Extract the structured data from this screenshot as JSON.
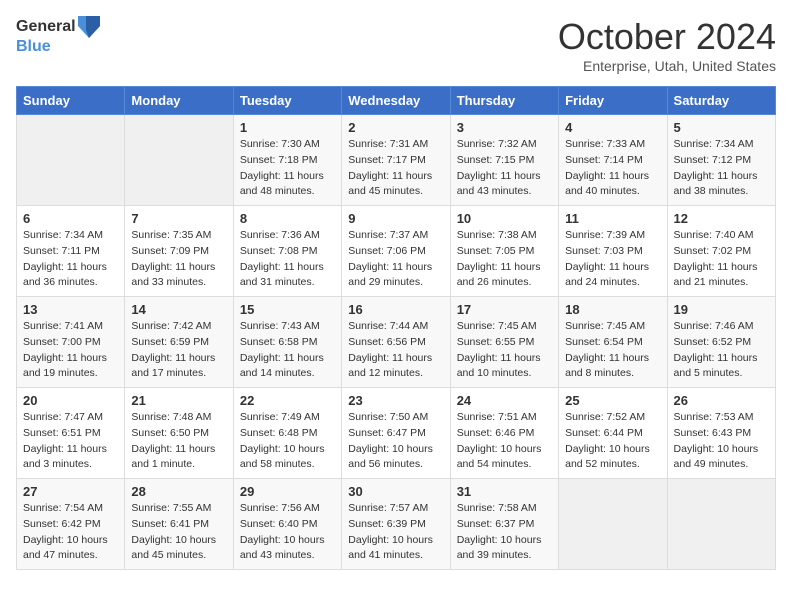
{
  "header": {
    "logo_general": "General",
    "logo_blue": "Blue",
    "month_title": "October 2024",
    "subtitle": "Enterprise, Utah, United States"
  },
  "weekdays": [
    "Sunday",
    "Monday",
    "Tuesday",
    "Wednesday",
    "Thursday",
    "Friday",
    "Saturday"
  ],
  "weeks": [
    [
      {
        "day": "",
        "sunrise": "",
        "sunset": "",
        "daylight": ""
      },
      {
        "day": "",
        "sunrise": "",
        "sunset": "",
        "daylight": ""
      },
      {
        "day": "1",
        "sunrise": "Sunrise: 7:30 AM",
        "sunset": "Sunset: 7:18 PM",
        "daylight": "Daylight: 11 hours and 48 minutes."
      },
      {
        "day": "2",
        "sunrise": "Sunrise: 7:31 AM",
        "sunset": "Sunset: 7:17 PM",
        "daylight": "Daylight: 11 hours and 45 minutes."
      },
      {
        "day": "3",
        "sunrise": "Sunrise: 7:32 AM",
        "sunset": "Sunset: 7:15 PM",
        "daylight": "Daylight: 11 hours and 43 minutes."
      },
      {
        "day": "4",
        "sunrise": "Sunrise: 7:33 AM",
        "sunset": "Sunset: 7:14 PM",
        "daylight": "Daylight: 11 hours and 40 minutes."
      },
      {
        "day": "5",
        "sunrise": "Sunrise: 7:34 AM",
        "sunset": "Sunset: 7:12 PM",
        "daylight": "Daylight: 11 hours and 38 minutes."
      }
    ],
    [
      {
        "day": "6",
        "sunrise": "Sunrise: 7:34 AM",
        "sunset": "Sunset: 7:11 PM",
        "daylight": "Daylight: 11 hours and 36 minutes."
      },
      {
        "day": "7",
        "sunrise": "Sunrise: 7:35 AM",
        "sunset": "Sunset: 7:09 PM",
        "daylight": "Daylight: 11 hours and 33 minutes."
      },
      {
        "day": "8",
        "sunrise": "Sunrise: 7:36 AM",
        "sunset": "Sunset: 7:08 PM",
        "daylight": "Daylight: 11 hours and 31 minutes."
      },
      {
        "day": "9",
        "sunrise": "Sunrise: 7:37 AM",
        "sunset": "Sunset: 7:06 PM",
        "daylight": "Daylight: 11 hours and 29 minutes."
      },
      {
        "day": "10",
        "sunrise": "Sunrise: 7:38 AM",
        "sunset": "Sunset: 7:05 PM",
        "daylight": "Daylight: 11 hours and 26 minutes."
      },
      {
        "day": "11",
        "sunrise": "Sunrise: 7:39 AM",
        "sunset": "Sunset: 7:03 PM",
        "daylight": "Daylight: 11 hours and 24 minutes."
      },
      {
        "day": "12",
        "sunrise": "Sunrise: 7:40 AM",
        "sunset": "Sunset: 7:02 PM",
        "daylight": "Daylight: 11 hours and 21 minutes."
      }
    ],
    [
      {
        "day": "13",
        "sunrise": "Sunrise: 7:41 AM",
        "sunset": "Sunset: 7:00 PM",
        "daylight": "Daylight: 11 hours and 19 minutes."
      },
      {
        "day": "14",
        "sunrise": "Sunrise: 7:42 AM",
        "sunset": "Sunset: 6:59 PM",
        "daylight": "Daylight: 11 hours and 17 minutes."
      },
      {
        "day": "15",
        "sunrise": "Sunrise: 7:43 AM",
        "sunset": "Sunset: 6:58 PM",
        "daylight": "Daylight: 11 hours and 14 minutes."
      },
      {
        "day": "16",
        "sunrise": "Sunrise: 7:44 AM",
        "sunset": "Sunset: 6:56 PM",
        "daylight": "Daylight: 11 hours and 12 minutes."
      },
      {
        "day": "17",
        "sunrise": "Sunrise: 7:45 AM",
        "sunset": "Sunset: 6:55 PM",
        "daylight": "Daylight: 11 hours and 10 minutes."
      },
      {
        "day": "18",
        "sunrise": "Sunrise: 7:45 AM",
        "sunset": "Sunset: 6:54 PM",
        "daylight": "Daylight: 11 hours and 8 minutes."
      },
      {
        "day": "19",
        "sunrise": "Sunrise: 7:46 AM",
        "sunset": "Sunset: 6:52 PM",
        "daylight": "Daylight: 11 hours and 5 minutes."
      }
    ],
    [
      {
        "day": "20",
        "sunrise": "Sunrise: 7:47 AM",
        "sunset": "Sunset: 6:51 PM",
        "daylight": "Daylight: 11 hours and 3 minutes."
      },
      {
        "day": "21",
        "sunrise": "Sunrise: 7:48 AM",
        "sunset": "Sunset: 6:50 PM",
        "daylight": "Daylight: 11 hours and 1 minute."
      },
      {
        "day": "22",
        "sunrise": "Sunrise: 7:49 AM",
        "sunset": "Sunset: 6:48 PM",
        "daylight": "Daylight: 10 hours and 58 minutes."
      },
      {
        "day": "23",
        "sunrise": "Sunrise: 7:50 AM",
        "sunset": "Sunset: 6:47 PM",
        "daylight": "Daylight: 10 hours and 56 minutes."
      },
      {
        "day": "24",
        "sunrise": "Sunrise: 7:51 AM",
        "sunset": "Sunset: 6:46 PM",
        "daylight": "Daylight: 10 hours and 54 minutes."
      },
      {
        "day": "25",
        "sunrise": "Sunrise: 7:52 AM",
        "sunset": "Sunset: 6:44 PM",
        "daylight": "Daylight: 10 hours and 52 minutes."
      },
      {
        "day": "26",
        "sunrise": "Sunrise: 7:53 AM",
        "sunset": "Sunset: 6:43 PM",
        "daylight": "Daylight: 10 hours and 49 minutes."
      }
    ],
    [
      {
        "day": "27",
        "sunrise": "Sunrise: 7:54 AM",
        "sunset": "Sunset: 6:42 PM",
        "daylight": "Daylight: 10 hours and 47 minutes."
      },
      {
        "day": "28",
        "sunrise": "Sunrise: 7:55 AM",
        "sunset": "Sunset: 6:41 PM",
        "daylight": "Daylight: 10 hours and 45 minutes."
      },
      {
        "day": "29",
        "sunrise": "Sunrise: 7:56 AM",
        "sunset": "Sunset: 6:40 PM",
        "daylight": "Daylight: 10 hours and 43 minutes."
      },
      {
        "day": "30",
        "sunrise": "Sunrise: 7:57 AM",
        "sunset": "Sunset: 6:39 PM",
        "daylight": "Daylight: 10 hours and 41 minutes."
      },
      {
        "day": "31",
        "sunrise": "Sunrise: 7:58 AM",
        "sunset": "Sunset: 6:37 PM",
        "daylight": "Daylight: 10 hours and 39 minutes."
      },
      {
        "day": "",
        "sunrise": "",
        "sunset": "",
        "daylight": ""
      },
      {
        "day": "",
        "sunrise": "",
        "sunset": "",
        "daylight": ""
      }
    ]
  ]
}
